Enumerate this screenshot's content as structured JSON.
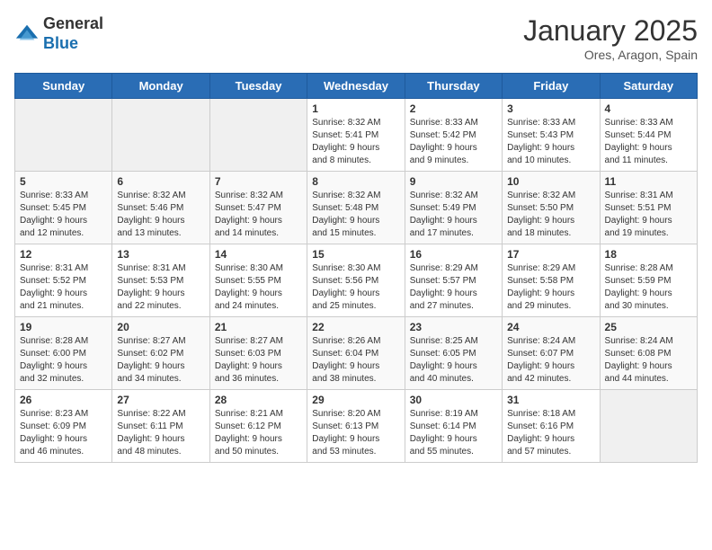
{
  "logo": {
    "general": "General",
    "blue": "Blue"
  },
  "header": {
    "month": "January 2025",
    "location": "Ores, Aragon, Spain"
  },
  "days_of_week": [
    "Sunday",
    "Monday",
    "Tuesday",
    "Wednesday",
    "Thursday",
    "Friday",
    "Saturday"
  ],
  "weeks": [
    [
      {
        "day": "",
        "info": ""
      },
      {
        "day": "",
        "info": ""
      },
      {
        "day": "",
        "info": ""
      },
      {
        "day": "1",
        "info": "Sunrise: 8:32 AM\nSunset: 5:41 PM\nDaylight: 9 hours\nand 8 minutes."
      },
      {
        "day": "2",
        "info": "Sunrise: 8:33 AM\nSunset: 5:42 PM\nDaylight: 9 hours\nand 9 minutes."
      },
      {
        "day": "3",
        "info": "Sunrise: 8:33 AM\nSunset: 5:43 PM\nDaylight: 9 hours\nand 10 minutes."
      },
      {
        "day": "4",
        "info": "Sunrise: 8:33 AM\nSunset: 5:44 PM\nDaylight: 9 hours\nand 11 minutes."
      }
    ],
    [
      {
        "day": "5",
        "info": "Sunrise: 8:33 AM\nSunset: 5:45 PM\nDaylight: 9 hours\nand 12 minutes."
      },
      {
        "day": "6",
        "info": "Sunrise: 8:32 AM\nSunset: 5:46 PM\nDaylight: 9 hours\nand 13 minutes."
      },
      {
        "day": "7",
        "info": "Sunrise: 8:32 AM\nSunset: 5:47 PM\nDaylight: 9 hours\nand 14 minutes."
      },
      {
        "day": "8",
        "info": "Sunrise: 8:32 AM\nSunset: 5:48 PM\nDaylight: 9 hours\nand 15 minutes."
      },
      {
        "day": "9",
        "info": "Sunrise: 8:32 AM\nSunset: 5:49 PM\nDaylight: 9 hours\nand 17 minutes."
      },
      {
        "day": "10",
        "info": "Sunrise: 8:32 AM\nSunset: 5:50 PM\nDaylight: 9 hours\nand 18 minutes."
      },
      {
        "day": "11",
        "info": "Sunrise: 8:31 AM\nSunset: 5:51 PM\nDaylight: 9 hours\nand 19 minutes."
      }
    ],
    [
      {
        "day": "12",
        "info": "Sunrise: 8:31 AM\nSunset: 5:52 PM\nDaylight: 9 hours\nand 21 minutes."
      },
      {
        "day": "13",
        "info": "Sunrise: 8:31 AM\nSunset: 5:53 PM\nDaylight: 9 hours\nand 22 minutes."
      },
      {
        "day": "14",
        "info": "Sunrise: 8:30 AM\nSunset: 5:55 PM\nDaylight: 9 hours\nand 24 minutes."
      },
      {
        "day": "15",
        "info": "Sunrise: 8:30 AM\nSunset: 5:56 PM\nDaylight: 9 hours\nand 25 minutes."
      },
      {
        "day": "16",
        "info": "Sunrise: 8:29 AM\nSunset: 5:57 PM\nDaylight: 9 hours\nand 27 minutes."
      },
      {
        "day": "17",
        "info": "Sunrise: 8:29 AM\nSunset: 5:58 PM\nDaylight: 9 hours\nand 29 minutes."
      },
      {
        "day": "18",
        "info": "Sunrise: 8:28 AM\nSunset: 5:59 PM\nDaylight: 9 hours\nand 30 minutes."
      }
    ],
    [
      {
        "day": "19",
        "info": "Sunrise: 8:28 AM\nSunset: 6:00 PM\nDaylight: 9 hours\nand 32 minutes."
      },
      {
        "day": "20",
        "info": "Sunrise: 8:27 AM\nSunset: 6:02 PM\nDaylight: 9 hours\nand 34 minutes."
      },
      {
        "day": "21",
        "info": "Sunrise: 8:27 AM\nSunset: 6:03 PM\nDaylight: 9 hours\nand 36 minutes."
      },
      {
        "day": "22",
        "info": "Sunrise: 8:26 AM\nSunset: 6:04 PM\nDaylight: 9 hours\nand 38 minutes."
      },
      {
        "day": "23",
        "info": "Sunrise: 8:25 AM\nSunset: 6:05 PM\nDaylight: 9 hours\nand 40 minutes."
      },
      {
        "day": "24",
        "info": "Sunrise: 8:24 AM\nSunset: 6:07 PM\nDaylight: 9 hours\nand 42 minutes."
      },
      {
        "day": "25",
        "info": "Sunrise: 8:24 AM\nSunset: 6:08 PM\nDaylight: 9 hours\nand 44 minutes."
      }
    ],
    [
      {
        "day": "26",
        "info": "Sunrise: 8:23 AM\nSunset: 6:09 PM\nDaylight: 9 hours\nand 46 minutes."
      },
      {
        "day": "27",
        "info": "Sunrise: 8:22 AM\nSunset: 6:11 PM\nDaylight: 9 hours\nand 48 minutes."
      },
      {
        "day": "28",
        "info": "Sunrise: 8:21 AM\nSunset: 6:12 PM\nDaylight: 9 hours\nand 50 minutes."
      },
      {
        "day": "29",
        "info": "Sunrise: 8:20 AM\nSunset: 6:13 PM\nDaylight: 9 hours\nand 53 minutes."
      },
      {
        "day": "30",
        "info": "Sunrise: 8:19 AM\nSunset: 6:14 PM\nDaylight: 9 hours\nand 55 minutes."
      },
      {
        "day": "31",
        "info": "Sunrise: 8:18 AM\nSunset: 6:16 PM\nDaylight: 9 hours\nand 57 minutes."
      },
      {
        "day": "",
        "info": ""
      }
    ]
  ]
}
